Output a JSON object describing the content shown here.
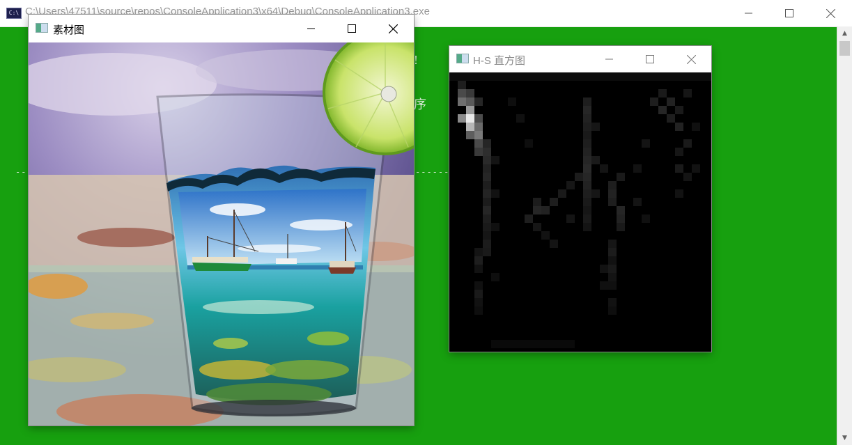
{
  "console": {
    "title": "C:\\Users\\47511\\source\\repos\\ConsoleApplication3\\x64\\Debug\\ConsoleApplication3.exe",
    "icon": "console-app-icon",
    "icon_text": "C:\\",
    "background_color": "#17a00f",
    "text_fragments": [
      "!",
      "序"
    ]
  },
  "material_window": {
    "title": "素材图",
    "icon": "app-window-icon"
  },
  "histogram_window": {
    "title": "H-S 直方图",
    "icon": "app-window-icon"
  },
  "window_controls": {
    "minimize_icon": "minimize-icon",
    "maximize_icon": "maximize-icon",
    "close_icon": "close-icon"
  },
  "scrollbar": {
    "up_icon": "scroll-up-arrow-icon",
    "down_icon": "scroll-down-arrow-icon"
  }
}
